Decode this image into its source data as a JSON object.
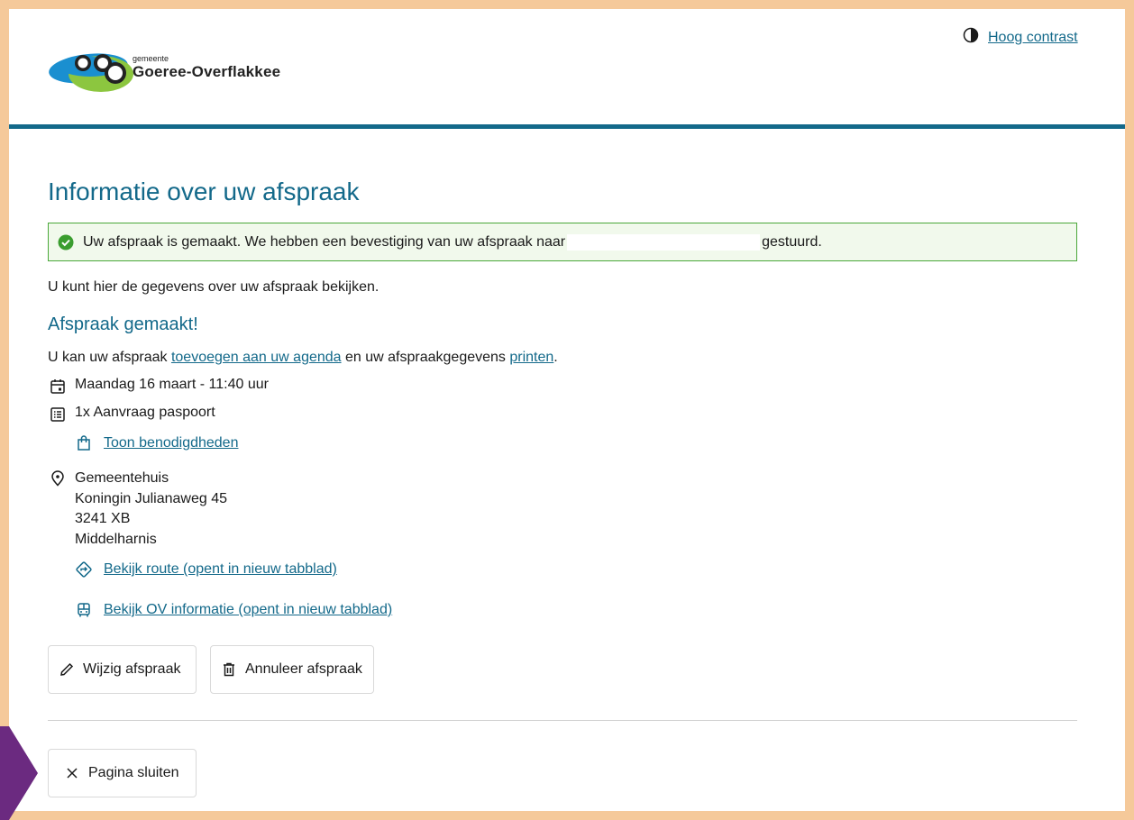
{
  "header": {
    "logo_small": "gemeente",
    "logo_big": "Goeree-Overflakkee",
    "contrast_label": "Hoog contrast",
    "colors": {
      "brand": "#13698a",
      "logo_blue": "#1a8fd0",
      "logo_green": "#8cc63f"
    }
  },
  "main": {
    "title": "Informatie over uw afspraak",
    "alert": {
      "text_before": "Uw afspraak is gemaakt. We hebben een bevestiging van uw afspraak naar",
      "text_after": "gestuurd.",
      "icon": "check-circle-icon",
      "color": "#4aa83a"
    },
    "intro": "U kunt hier de gegevens over uw afspraak bekijken.",
    "subtitle": "Afspraak gemaakt!",
    "agenda": {
      "prefix": "U kan uw afspraak ",
      "agenda_link": "toevoegen aan uw agenda",
      "middle": " en uw afspraakgegevens ",
      "print_link": "printen",
      "suffix": "."
    },
    "date_time": "Maandag 16 maart - 11:40 uur",
    "product": "1x Aanvraag paspoort",
    "requirements_link": "Toon benodigdheden",
    "location": {
      "name": "Gemeentehuis",
      "street": "Koningin Julianaweg 45",
      "postcode": "3241 XB",
      "city": "Middelharnis"
    },
    "route_link": "Bekijk route (opent in nieuw tabblad)",
    "ov_link": "Bekijk OV informatie (opent in nieuw tabblad)",
    "buttons": {
      "change": "Wijzig afspraak",
      "cancel": "Annuleer afspraak",
      "close": "Pagina sluiten"
    }
  }
}
